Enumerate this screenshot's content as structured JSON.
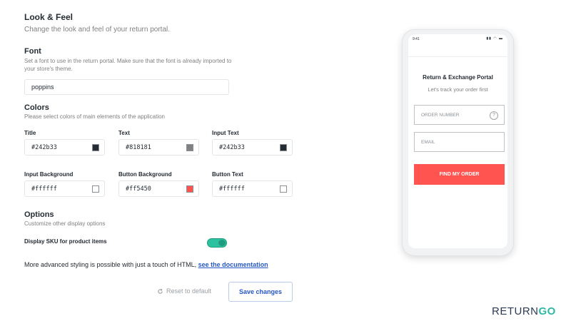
{
  "header": {
    "title": "Look & Feel",
    "subtitle": "Change the look and feel of your return portal."
  },
  "font": {
    "title": "Font",
    "description_line1": "Set a font to use in the return portal. Make sure that the font is already imported to",
    "description_line2": "your store's theme.",
    "value": "poppins"
  },
  "colors": {
    "title": "Colors",
    "description": "Please select colors of main elements of the application",
    "fields": [
      {
        "label": "Title",
        "value": "#242b33",
        "swatch": "#242b33"
      },
      {
        "label": "Text",
        "value": "#818181",
        "swatch": "#818181"
      },
      {
        "label": "Input Text",
        "value": "#242b33",
        "swatch": "#242b33"
      },
      {
        "label": "Input Background",
        "value": "#ffffff",
        "swatch": "#ffffff"
      },
      {
        "label": "Button Background",
        "value": "#ff5450",
        "swatch": "#ff5450"
      },
      {
        "label": "Button Text",
        "value": "#ffffff",
        "swatch": "#ffffff"
      }
    ]
  },
  "options": {
    "title": "Options",
    "description": "Customize other display options",
    "sku_label": "Display SKU for product items",
    "sku_enabled": true
  },
  "advanced": {
    "text": "More advanced styling is possible with just a touch of HTML,",
    "link": "see the documentation"
  },
  "actions": {
    "reset_label": "Reset to default",
    "save_label": "Save changes"
  },
  "preview": {
    "status_time": "9:41",
    "status_icons": "▮▮ ◠ ▬",
    "title": "Return & Exchange Portal",
    "subtitle": "Let's track your order first",
    "order_placeholder": "ORDER NUMBER",
    "help_icon": "?",
    "email_placeholder": "EMAIL",
    "button_label": "FIND MY ORDER"
  },
  "brand": {
    "part1": "RETURN",
    "part2": "GO"
  }
}
